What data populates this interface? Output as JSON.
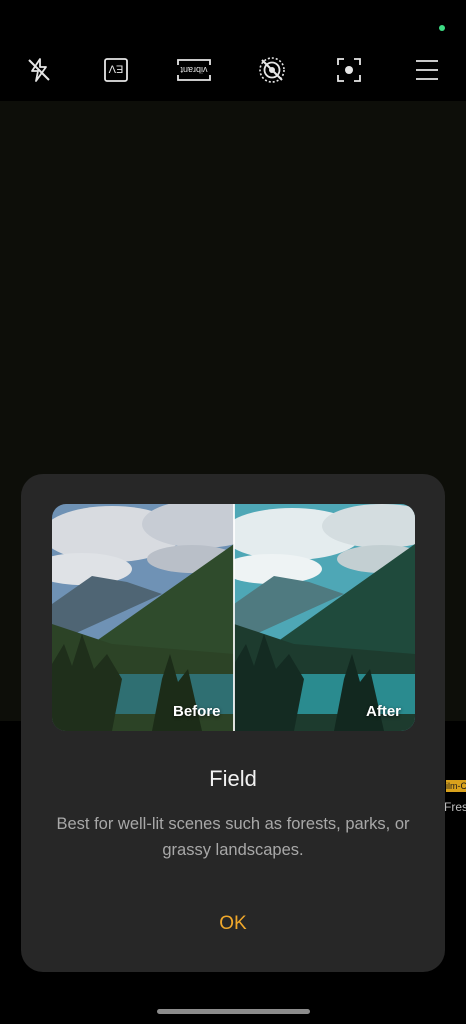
{
  "toolbar": {
    "items": [
      {
        "icon": "flash-off-icon"
      },
      {
        "icon": "exposure-icon",
        "label": "EV"
      },
      {
        "icon": "vibrant-filter-icon",
        "label": "vibrant"
      },
      {
        "icon": "live-photo-off-icon"
      },
      {
        "icon": "focus-icon"
      },
      {
        "icon": "menu-icon"
      }
    ]
  },
  "side_filter": {
    "badge": "ilm-C",
    "label": "Fres"
  },
  "dialog": {
    "before_label": "Before",
    "after_label": "After",
    "title": "Field",
    "description": "Best for well-lit scenes such as forests, parks, or grassy landscapes.",
    "ok_label": "OK"
  },
  "colors": {
    "accent": "#f0a82b",
    "dialog_bg": "#272727",
    "status_dot": "#3ddc84"
  }
}
